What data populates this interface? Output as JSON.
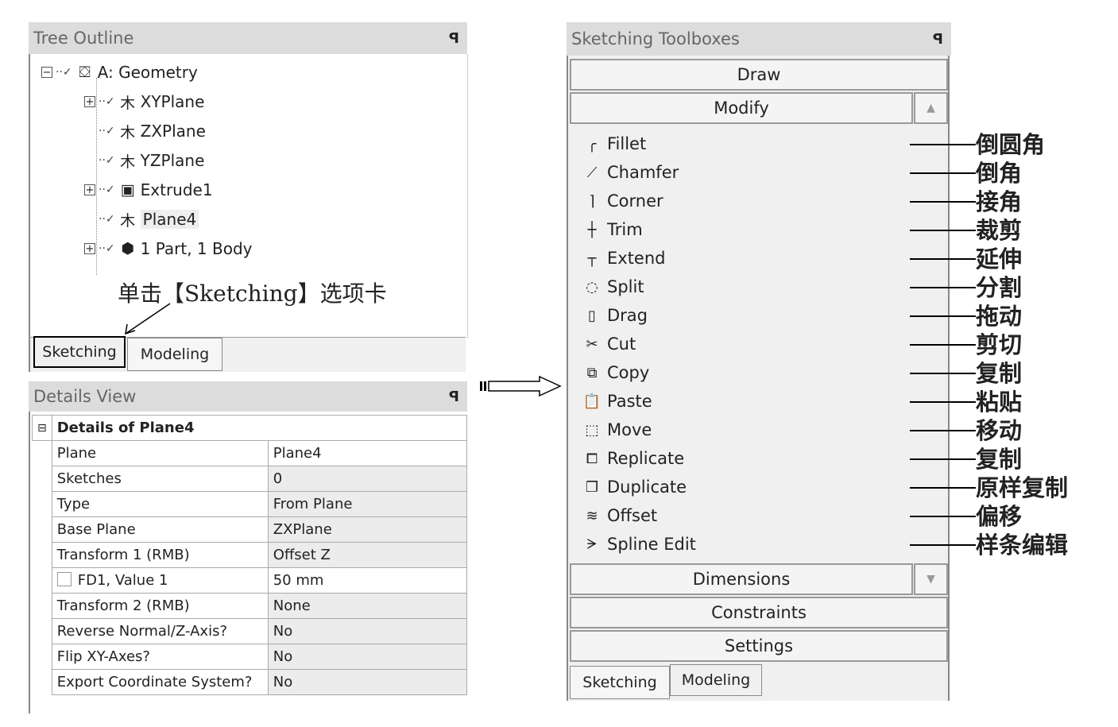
{
  "tree_outline": {
    "title": "Tree Outline",
    "pin": "⊥",
    "nodes": [
      {
        "label": "A: Geometry",
        "icon": "geometry-icon",
        "expander": "−"
      },
      {
        "label": "XYPlane",
        "icon": "plane-icon",
        "expander": "+"
      },
      {
        "label": "ZXPlane",
        "icon": "plane-icon",
        "expander": ""
      },
      {
        "label": "YZPlane",
        "icon": "plane-icon",
        "expander": ""
      },
      {
        "label": "Extrude1",
        "icon": "extrude-icon",
        "expander": "+"
      },
      {
        "label": "Plane4",
        "icon": "plane-icon",
        "expander": "",
        "selected": true
      },
      {
        "label": "1 Part, 1 Body",
        "icon": "body-icon",
        "expander": "+"
      }
    ],
    "annotation": "单击【Sketching】选项卡",
    "tabs": [
      "Sketching",
      "Modeling"
    ]
  },
  "details_view": {
    "title": "Details View",
    "pin": "⊥",
    "section": "Details of Plane4",
    "rows": [
      [
        "Plane",
        "Plane4"
      ],
      [
        "Sketches",
        "0"
      ],
      [
        "Type",
        "From Plane"
      ],
      [
        "Base Plane",
        "ZXPlane"
      ],
      [
        "Transform 1 (RMB)",
        "Offset Z"
      ],
      [
        "FD1, Value 1",
        "50 mm"
      ],
      [
        "Transform 2 (RMB)",
        "None"
      ],
      [
        "Reverse Normal/Z-Axis?",
        "No"
      ],
      [
        "Flip XY-Axes?",
        "No"
      ],
      [
        "Export Coordinate System?",
        "No"
      ]
    ]
  },
  "toolboxes": {
    "title": "Sketching Toolboxes",
    "pin": "⊥",
    "draw": "Draw",
    "modify": "Modify",
    "dimensions": "Dimensions",
    "constraints": "Constraints",
    "settings": "Settings",
    "tools": [
      {
        "label": "Fillet",
        "icon": "fillet-icon",
        "glyph": "╭",
        "note": "倒圆角"
      },
      {
        "label": "Chamfer",
        "icon": "chamfer-icon",
        "glyph": "⟋",
        "note": "倒角"
      },
      {
        "label": "Corner",
        "icon": "corner-icon",
        "glyph": "⌉",
        "note": "接角"
      },
      {
        "label": "Trim",
        "icon": "trim-icon",
        "glyph": "┼",
        "note": "裁剪"
      },
      {
        "label": "Extend",
        "icon": "extend-icon",
        "glyph": "┬",
        "note": "延伸"
      },
      {
        "label": "Split",
        "icon": "split-icon",
        "glyph": "◌",
        "note": "分割"
      },
      {
        "label": "Drag",
        "icon": "drag-icon",
        "glyph": "▯",
        "note": "拖动"
      },
      {
        "label": "Cut",
        "icon": "scissors-icon",
        "glyph": "✂",
        "note": "剪切"
      },
      {
        "label": "Copy",
        "icon": "copy-icon",
        "glyph": "⧉",
        "note": "复制"
      },
      {
        "label": "Paste",
        "icon": "paste-icon",
        "glyph": "📋",
        "note": "粘贴"
      },
      {
        "label": "Move",
        "icon": "move-icon",
        "glyph": "⬚",
        "note": "移动"
      },
      {
        "label": "Replicate",
        "icon": "replicate-icon",
        "glyph": "⧠",
        "note": "复制"
      },
      {
        "label": "Duplicate",
        "icon": "duplicate-icon",
        "glyph": "❐",
        "note": "原样复制"
      },
      {
        "label": "Offset",
        "icon": "offset-icon",
        "glyph": "≋",
        "note": "偏移"
      },
      {
        "label": "Spline Edit",
        "icon": "spline-edit-icon",
        "glyph": "ᗒ",
        "note": "样条编辑"
      }
    ],
    "tabs": [
      "Sketching",
      "Modeling"
    ]
  }
}
